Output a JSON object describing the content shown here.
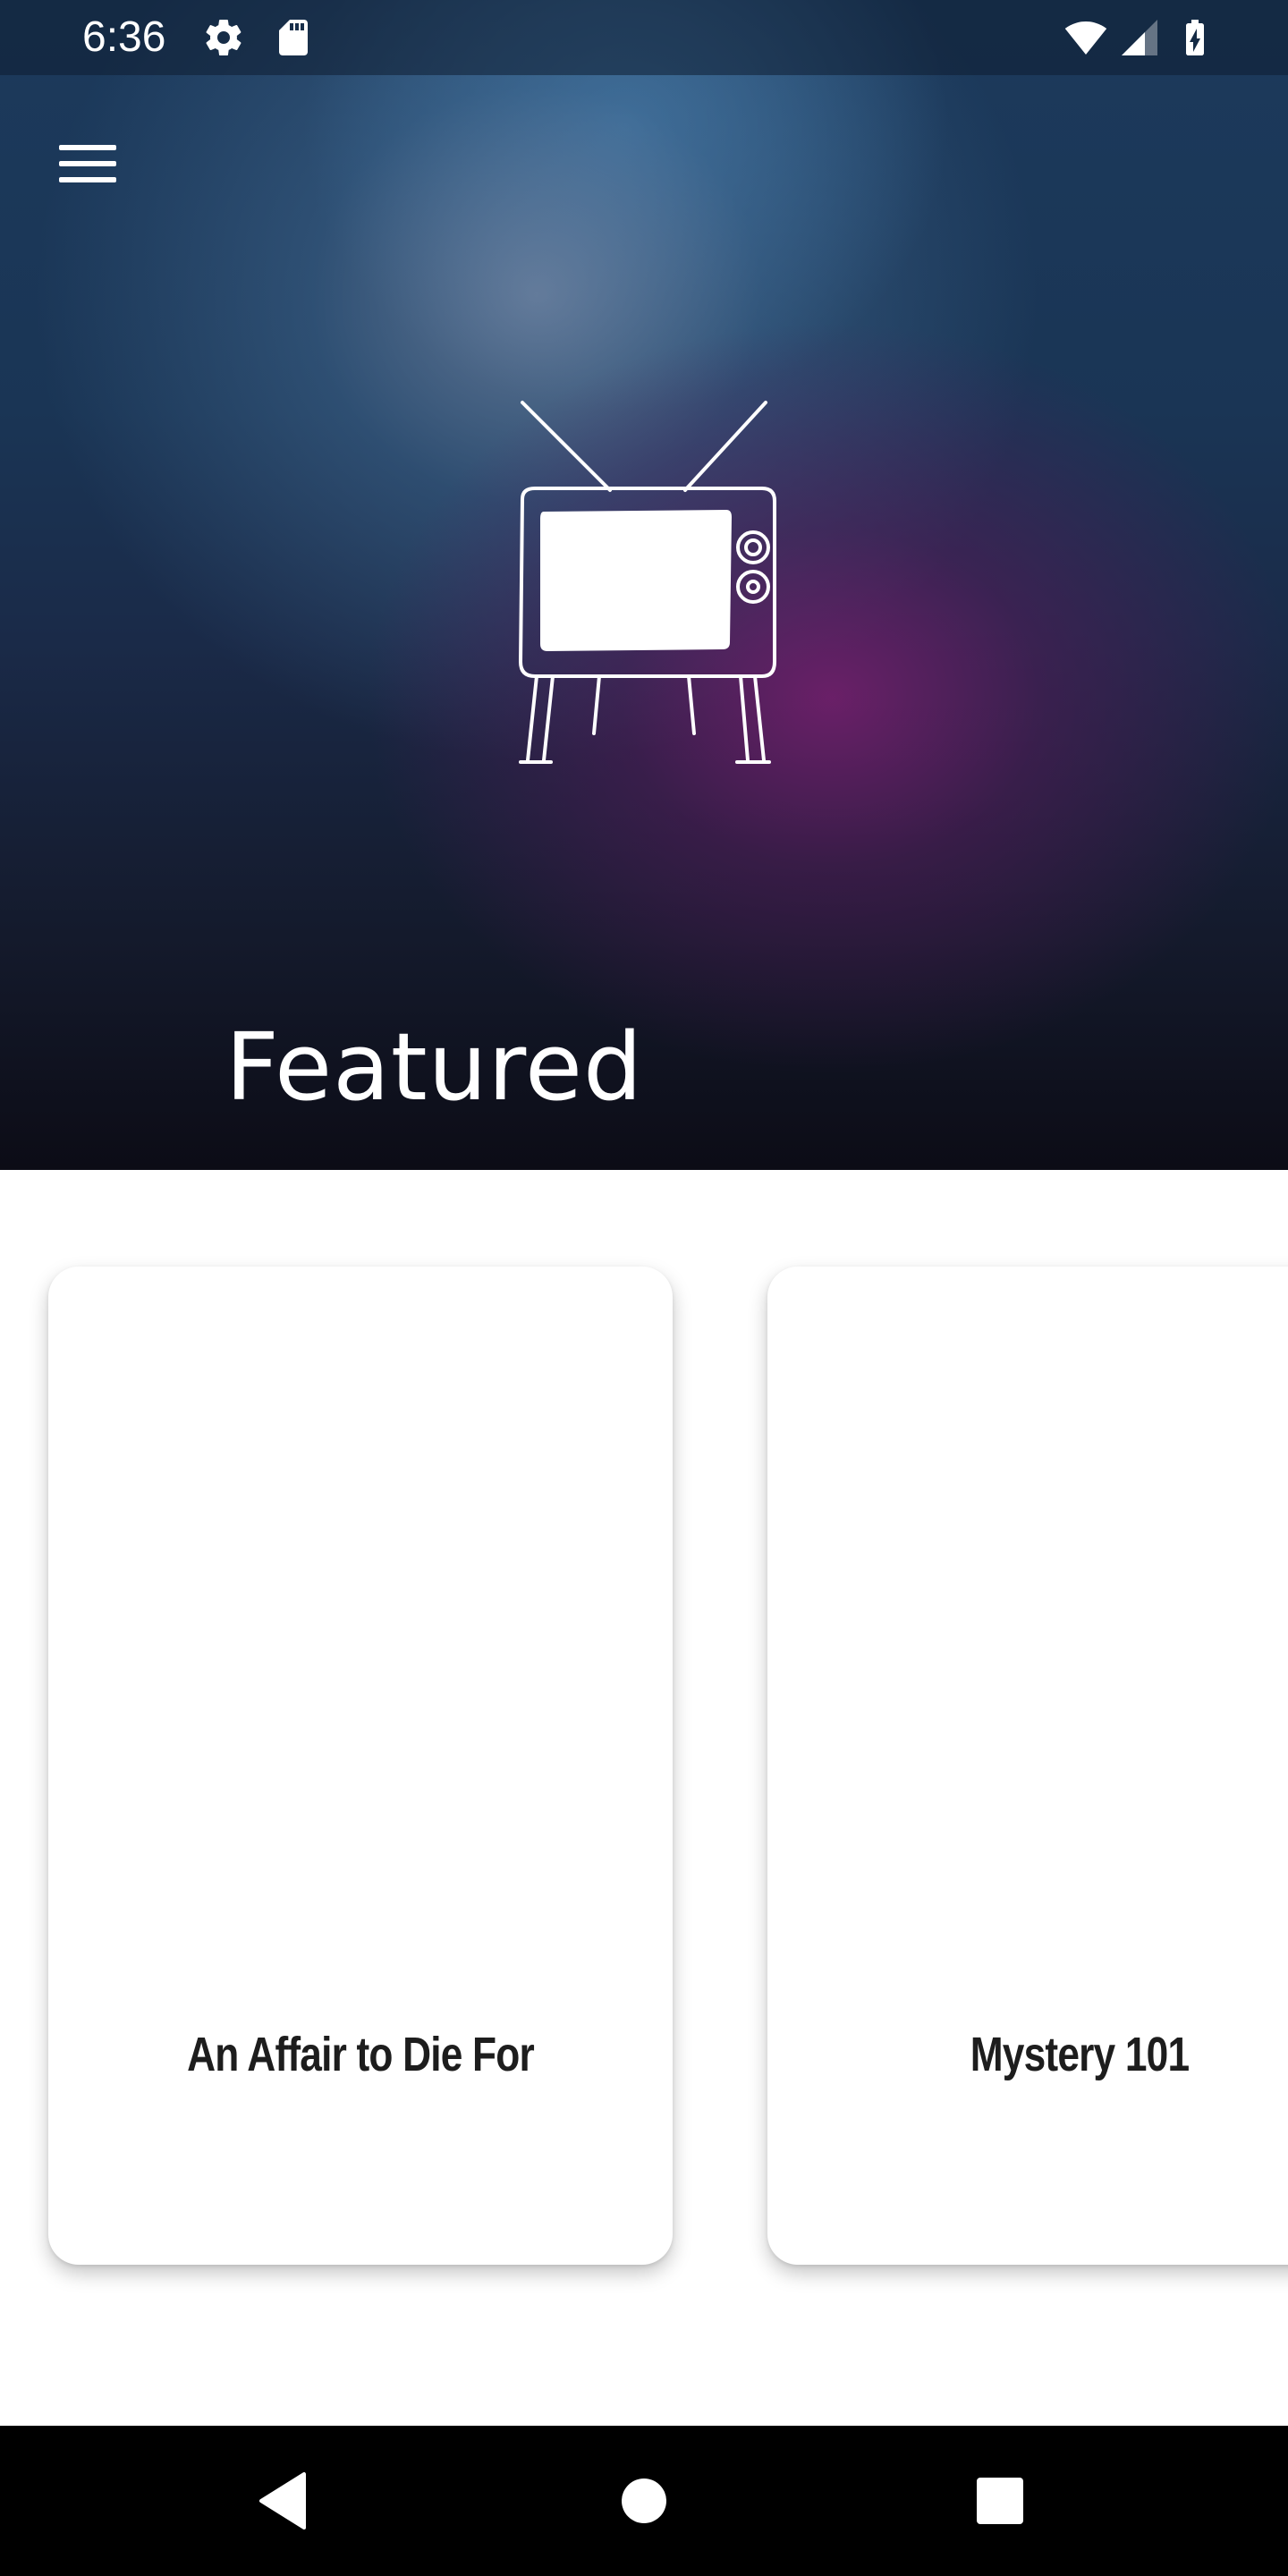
{
  "status_bar": {
    "time": "6:36",
    "icons": [
      "settings-icon",
      "sd-card-icon",
      "wifi-icon",
      "signal-icon",
      "battery-charging-icon"
    ]
  },
  "header": {
    "menu_icon": "hamburger-menu-icon",
    "logo_icon": "retro-tv-icon",
    "title": "Featured"
  },
  "featured": {
    "cards": [
      {
        "title": "An Affair to Die For"
      },
      {
        "title": "Mystery 101"
      }
    ]
  },
  "nav_bar": {
    "buttons": [
      "back-icon",
      "home-icon",
      "recents-icon"
    ]
  },
  "colors": {
    "hero_top": "#1c3a5c",
    "hero_accent": "#781e6e",
    "hero_bottom": "#0c0c16",
    "card_text": "#1d1d1d",
    "nav_bar": "#000000"
  }
}
